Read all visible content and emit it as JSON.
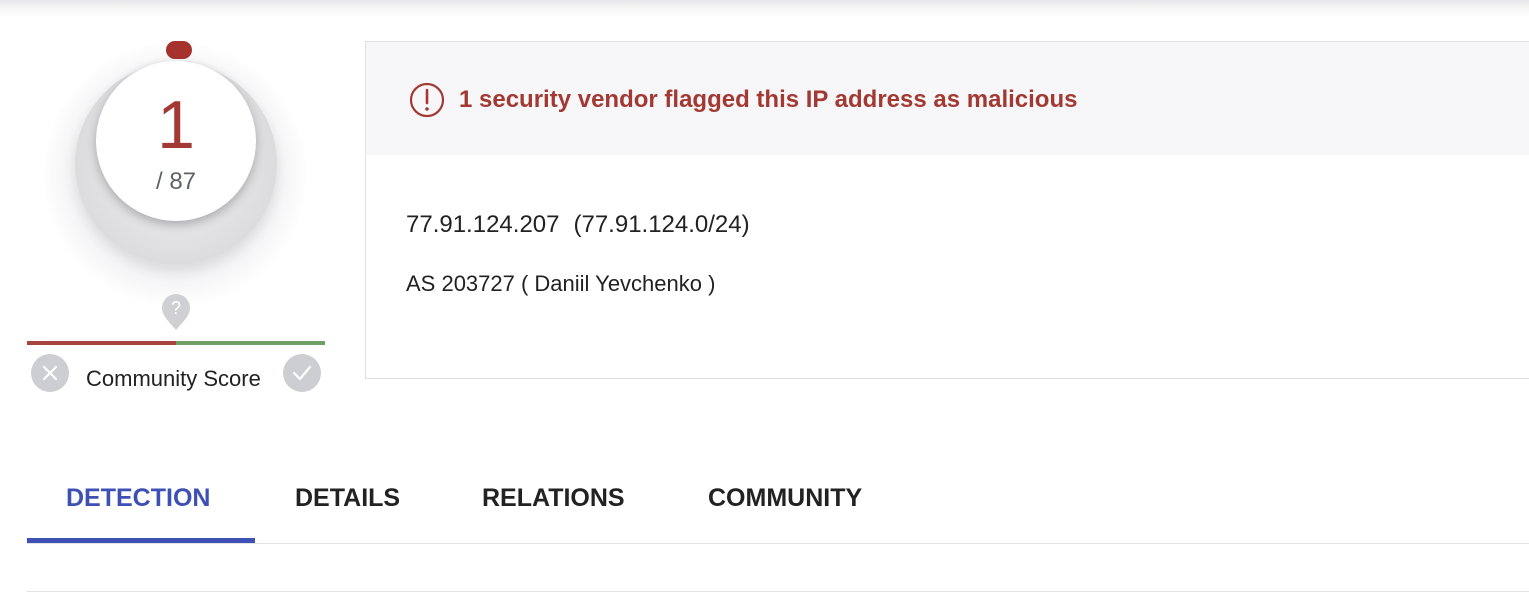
{
  "detection_score": {
    "malicious": "1",
    "total": "/ 87",
    "flagged_fraction": 0.0115,
    "colors": {
      "malicious": "#a23a33",
      "ring": "#dcdcdf"
    }
  },
  "community": {
    "label": "Community Score",
    "marker_glyph": "?",
    "colors": {
      "negative": "#a8443e",
      "positive": "#6f9f64"
    },
    "vote_down_icon": "close-icon",
    "vote_up_icon": "check-icon"
  },
  "alert": {
    "icon": "exclamation-circle-icon",
    "text": "1 security vendor flagged this IP address as malicious",
    "color": "#a23a33"
  },
  "ip_info": {
    "ip": "77.91.124.207",
    "range": "(77.91.124.0/24)",
    "asn": "AS 203727 ( Daniil Yevchenko )"
  },
  "tabs": [
    {
      "label": "DETECTION",
      "active": true
    },
    {
      "label": "DETAILS",
      "active": false
    },
    {
      "label": "RELATIONS",
      "active": false
    },
    {
      "label": "COMMUNITY",
      "active": false
    }
  ],
  "accent_color": "#3e50b4"
}
